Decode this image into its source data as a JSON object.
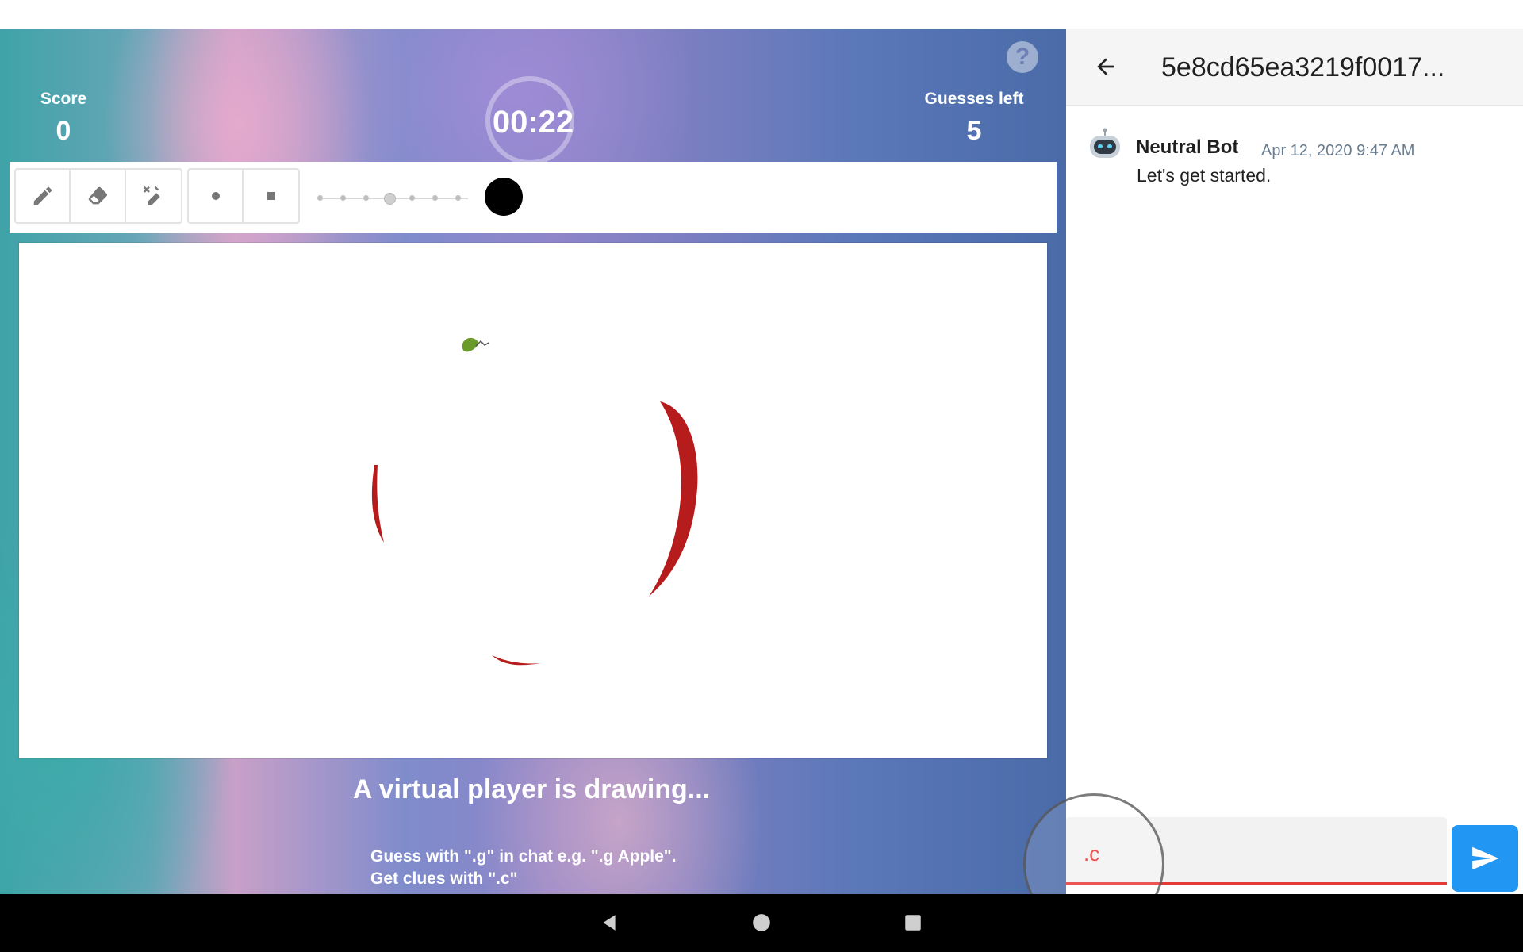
{
  "game": {
    "help_icon": "?",
    "score_label": "Score",
    "score_value": "0",
    "timer": "00:22",
    "guesses_label": "Guesses left",
    "guesses_value": "5",
    "tools": [
      "pencil-icon",
      "eraser-icon",
      "clear-icon",
      "round-brush-icon",
      "square-brush-icon"
    ],
    "brush_color": "#000000",
    "status_title": "A virtual player is drawing...",
    "hint_line1": "Guess with \".g\" in chat e.g. \".g Apple\".",
    "hint_line2": "Get clues with \".c\""
  },
  "chat": {
    "title": "5e8cd65ea3219f0017...",
    "messages": [
      {
        "author": "Neutral Bot",
        "time": "Apr 12, 2020 9:47 AM",
        "text": "Let's get started."
      }
    ],
    "input_value": ".c",
    "accent_color": "#e53935",
    "send_color": "#2196f3"
  },
  "navbar": {
    "buttons": [
      "back-icon",
      "home-icon",
      "recents-icon"
    ]
  }
}
